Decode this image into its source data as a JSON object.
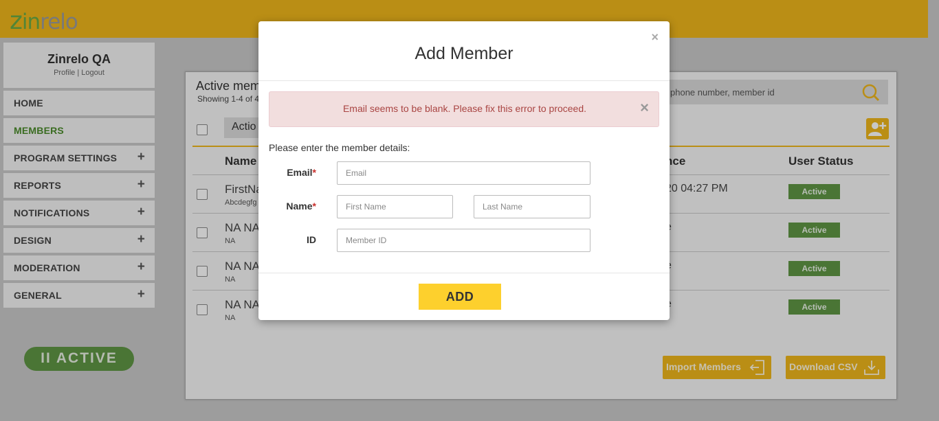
{
  "brand": {
    "logo_z": "z",
    "logo_in": "in",
    "logo_relo": "relo"
  },
  "sidebar": {
    "account_name": "Zinrelo QA",
    "profile_link": "Profile",
    "link_separator": "|",
    "logout_link": "Logout",
    "items": [
      {
        "label": "HOME",
        "expandable": false
      },
      {
        "label": "MEMBERS",
        "expandable": false,
        "selected": true
      },
      {
        "label": "PROGRAM SETTINGS",
        "expandable": true
      },
      {
        "label": "REPORTS",
        "expandable": true
      },
      {
        "label": "NOTIFICATIONS",
        "expandable": true
      },
      {
        "label": "DESIGN",
        "expandable": true
      },
      {
        "label": "MODERATION",
        "expandable": true
      },
      {
        "label": "GENERAL",
        "expandable": true
      }
    ],
    "expand_glyph": "+",
    "status_label": "ACTIVE",
    "status_glyph": "II"
  },
  "members_panel": {
    "title": "Active mem",
    "showing": "Showing 1-4 of 4",
    "search_placeholder": "phone number, member id",
    "actions_label": "Actio",
    "columns": {
      "name": "Name",
      "balance": "nce",
      "status": "User Status"
    },
    "rows": [
      {
        "name": "FirstNa",
        "sub": "Abcdegfg",
        "balance": "20 04:27 PM",
        "status": "Active"
      },
      {
        "name": "NA NA",
        "sub": "NA",
        "balance": "e",
        "status": "Active"
      },
      {
        "name": "NA NA",
        "sub": "NA",
        "balance": "e",
        "status": "Active"
      },
      {
        "name": "NA NA",
        "sub": "NA",
        "balance": "e",
        "status": "Active"
      }
    ],
    "import_label": "Import Members",
    "download_label": "Download CSV"
  },
  "modal": {
    "title": "Add Member",
    "close_glyph": "×",
    "alert": {
      "message": "Email seems to be blank. Please fix this error to proceed.",
      "close_glyph": "×"
    },
    "intro": "Please enter the member details:",
    "email": {
      "label": "Email",
      "required": "*",
      "value": "",
      "placeholder": "Email"
    },
    "name": {
      "label": "Name",
      "required": "*",
      "first_placeholder": "First Name",
      "last_placeholder": "Last Name"
    },
    "id": {
      "label": "ID",
      "placeholder": "Member ID"
    },
    "submit_label": "ADD"
  },
  "colors": {
    "brand_yellow": "#efb71c",
    "brand_green": "#5f9645",
    "alert_bg": "#f2dede",
    "alert_text": "#a94442",
    "add_button": "#fdd02d"
  }
}
